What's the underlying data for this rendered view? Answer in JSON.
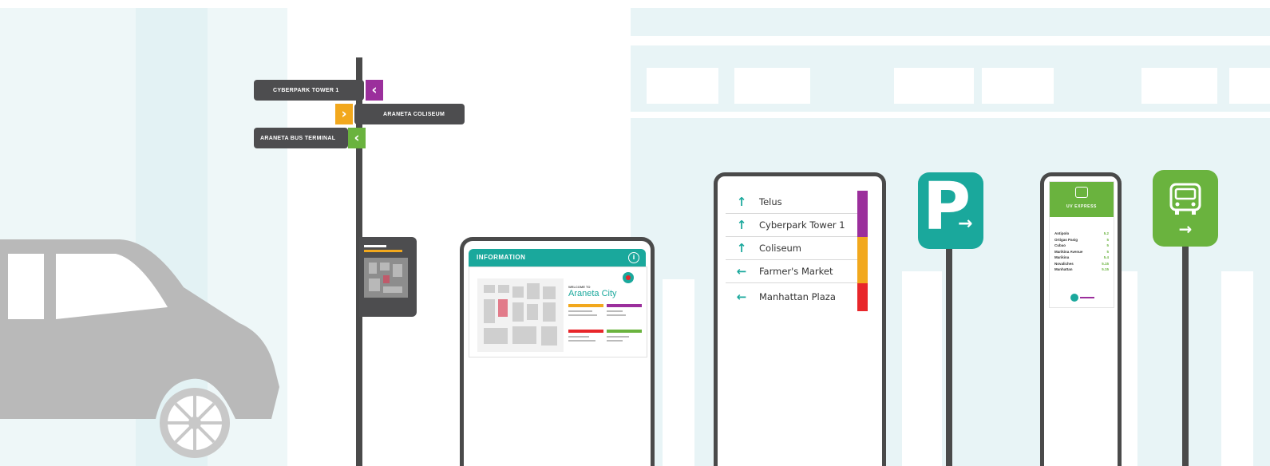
{
  "wayfinding_signs": [
    {
      "label": "CYBERPARK TOWER 1",
      "direction": "left",
      "color": "#9b2f9c"
    },
    {
      "label": "ARANETA COLISEUM",
      "direction": "right",
      "color": "#f2a81d"
    },
    {
      "label": "ARANETA BUS TERMINAL",
      "direction": "left",
      "color": "#6ab33e"
    }
  ],
  "map_kiosk": {
    "title": "INFORMATION",
    "info_icon": "info-icon",
    "welcome_text": "WELCOME TO",
    "city_name": "Araneta City"
  },
  "directory": {
    "items": [
      {
        "label": "Telus",
        "arrow": "↑",
        "tab_color": "#9b2f9c"
      },
      {
        "label": "Cyberpark Tower 1",
        "arrow": "↑",
        "tab_color": "#9b2f9c"
      },
      {
        "label": "Coliseum",
        "arrow": "↑",
        "tab_color": "#f2a81d"
      },
      {
        "label": "Farmer's Market",
        "arrow": "←",
        "tab_color": "#f2a81d"
      },
      {
        "label": "Manhattan Plaza",
        "arrow": "←",
        "tab_color": "#e8262a"
      }
    ]
  },
  "parking_sign": {
    "letter": "P",
    "arrow": "→",
    "color": "#1aa89c"
  },
  "bus_schedule": {
    "title": "UV EXPRESS",
    "rows": [
      {
        "place": "Antipolo",
        "fare": "5.2"
      },
      {
        "place": "Ortigas Pasig",
        "fare": "5"
      },
      {
        "place": "Cubao",
        "fare": "5"
      },
      {
        "place": "Marikina Avenue",
        "fare": "5"
      },
      {
        "place": "Marikina",
        "fare": "5.4"
      },
      {
        "place": "Novaliches",
        "fare": "5.15"
      },
      {
        "place": "Manhattan",
        "fare": "5.15"
      }
    ]
  },
  "bus_sign": {
    "arrow": "→",
    "color": "#6ab33e"
  },
  "colors": {
    "background_tint": "#e8f4f6",
    "pole": "#4a4a4a",
    "car": "#b9b9b9"
  }
}
